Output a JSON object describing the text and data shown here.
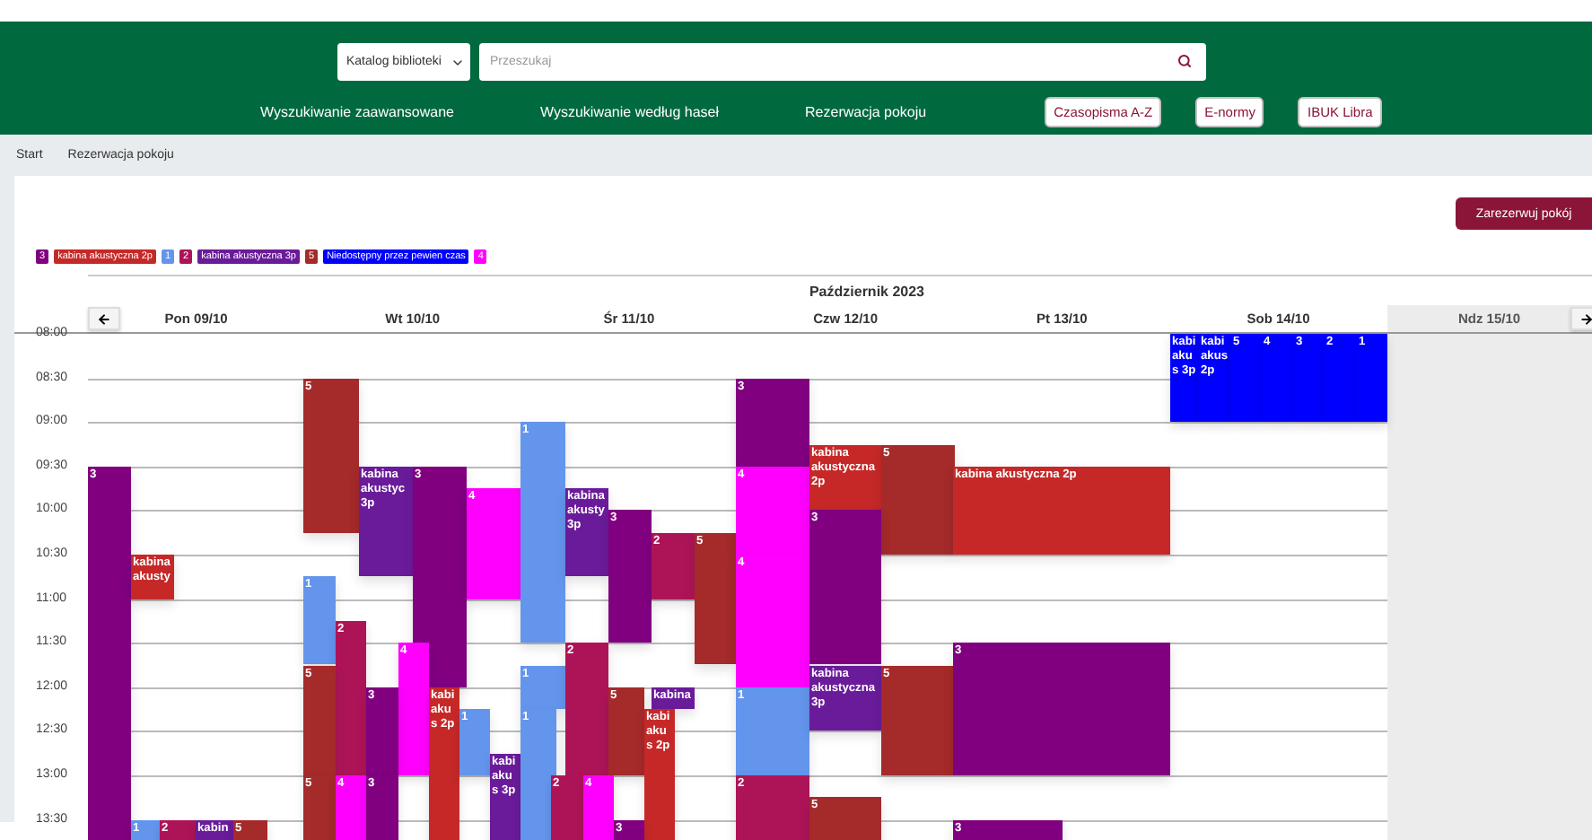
{
  "header": {
    "catalog_select": "Katalog biblioteki",
    "search": {
      "placeholder": "Przeszukaj"
    },
    "links": [
      "Wyszukiwanie zaawansowane",
      "Wyszukiwanie według haseł",
      "Rezerwacja pokoju"
    ],
    "buttons": [
      "Czasopisma A-Z",
      "E-normy",
      "IBUK Libra"
    ]
  },
  "breadcrumb": [
    "Start",
    "Rezerwacja pokoju"
  ],
  "reserve_button": "Zarezerwuj pokój",
  "legend": [
    {
      "label": "3",
      "color": "#800080"
    },
    {
      "label": "kabina akustyczna 2p",
      "color": "#c62828"
    },
    {
      "label": "1",
      "color": "#6495ed"
    },
    {
      "label": "2",
      "color": "#ad1457"
    },
    {
      "label": "kabina akustyczna 3p",
      "color": "#6a1b9a"
    },
    {
      "label": "5",
      "color": "#a52a2a"
    },
    {
      "label": "Niedostępny przez pewien czas",
      "color": "#0000ff"
    },
    {
      "label": "4",
      "color": "#ff00ff"
    }
  ],
  "calendar": {
    "month": "Październik 2023",
    "days": [
      {
        "label": "Pon 09/10",
        "disabled": false
      },
      {
        "label": "Wt 10/10",
        "disabled": false
      },
      {
        "label": "Śr 11/10",
        "disabled": false
      },
      {
        "label": "Czw 12/10",
        "disabled": false
      },
      {
        "label": "Pt 13/10",
        "disabled": false
      },
      {
        "label": "Sob 14/10",
        "disabled": false
      },
      {
        "label": "Ndz 15/10",
        "disabled": true
      }
    ],
    "times": [
      "08:00",
      "08:30",
      "09:00",
      "09:30",
      "10:00",
      "10:30",
      "11:00",
      "11:30",
      "12:00",
      "12:30",
      "13:00",
      "13:30"
    ],
    "events": [
      {
        "label": "3",
        "color": "#800080"
      },
      {
        "label": "kabina akusty",
        "color": "#c62828"
      },
      {
        "label": "1",
        "color": "#6495ed"
      },
      {
        "label": "2",
        "color": "#ad1457"
      },
      {
        "label": "kabin",
        "color": "#6a1b9a"
      },
      {
        "label": "5",
        "color": "#a52a2a"
      },
      {
        "label": "5",
        "color": "#a52a2a"
      },
      {
        "label": "kabina akustyc 3p",
        "color": "#6a1b9a"
      },
      {
        "label": "3",
        "color": "#800080"
      },
      {
        "label": "4",
        "color": "#ff00ff"
      },
      {
        "label": "1",
        "color": "#6495ed"
      },
      {
        "label": "2",
        "color": "#ad1457"
      },
      {
        "label": "5",
        "color": "#a52a2a"
      },
      {
        "label": "4",
        "color": "#ff00ff"
      },
      {
        "label": "3",
        "color": "#800080"
      },
      {
        "label": "kabi akus 2p",
        "color": "#c62828"
      },
      {
        "label": "1",
        "color": "#6495ed"
      },
      {
        "label": "kabi akus 3p",
        "color": "#6a1b9a"
      },
      {
        "label": "5",
        "color": "#a52a2a"
      },
      {
        "label": "4",
        "color": "#ff00ff"
      },
      {
        "label": "3",
        "color": "#800080"
      },
      {
        "label": "1",
        "color": "#6495ed"
      },
      {
        "label": "kabina akusty 3p",
        "color": "#6a1b9a"
      },
      {
        "label": "3",
        "color": "#800080"
      },
      {
        "label": "2",
        "color": "#ad1457"
      },
      {
        "label": "5",
        "color": "#a52a2a"
      },
      {
        "label": "1",
        "color": "#6495ed"
      },
      {
        "label": "1",
        "color": "#6495ed"
      },
      {
        "label": "2",
        "color": "#ad1457"
      },
      {
        "label": "5",
        "color": "#a52a2a"
      },
      {
        "label": "kabina",
        "color": "#6a1b9a"
      },
      {
        "label": "kabi akus 2p",
        "color": "#c62828"
      },
      {
        "label": "2",
        "color": "#ad1457"
      },
      {
        "label": "4",
        "color": "#ff00ff"
      },
      {
        "label": "3",
        "color": "#800080"
      },
      {
        "label": "3",
        "color": "#800080"
      },
      {
        "label": "4",
        "color": "#ff00ff"
      },
      {
        "label": "4",
        "color": "#ff00ff"
      },
      {
        "label": "1",
        "color": "#6495ed"
      },
      {
        "label": "2",
        "color": "#ad1457"
      },
      {
        "label": "kabina akustyczna 2p",
        "color": "#c62828"
      },
      {
        "label": "5",
        "color": "#a52a2a"
      },
      {
        "label": "3",
        "color": "#800080"
      },
      {
        "label": "kabina akustyczna 3p",
        "color": "#6a1b9a"
      },
      {
        "label": "5",
        "color": "#a52a2a"
      },
      {
        "label": "5",
        "color": "#a52a2a"
      },
      {
        "label": "kabina akustyczna 2p",
        "color": "#c62828"
      },
      {
        "label": "3",
        "color": "#800080"
      },
      {
        "label": "3",
        "color": "#800080"
      },
      {
        "label": "kabi akus 3p",
        "color": "#0000ff"
      },
      {
        "label": "kabi akus 2p",
        "color": "#0000ff"
      },
      {
        "label": "5",
        "color": "#0000ff"
      },
      {
        "label": "4",
        "color": "#0000ff"
      },
      {
        "label": "3",
        "color": "#0000ff"
      },
      {
        "label": "2",
        "color": "#0000ff"
      },
      {
        "label": "1",
        "color": "#0000ff"
      }
    ]
  }
}
